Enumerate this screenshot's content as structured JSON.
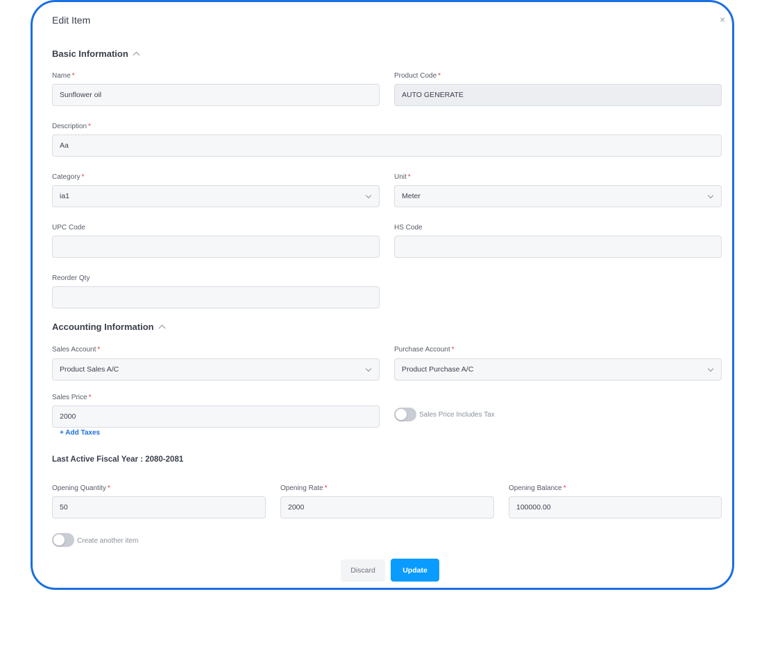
{
  "dialog": {
    "title": "Edit Item",
    "close_label": "×"
  },
  "basic": {
    "title": "Basic Information",
    "name": {
      "label": "Name",
      "value": "Sunflower oil"
    },
    "product_code": {
      "label": "Product Code",
      "value": "AUTO GENERATE"
    },
    "description": {
      "label": "Description",
      "value": "Aa"
    },
    "category": {
      "label": "Category",
      "value": "ia1"
    },
    "unit": {
      "label": "Unit",
      "value": "Meter"
    },
    "upc_code": {
      "label": "UPC Code",
      "value": ""
    },
    "hs_code": {
      "label": "HS Code",
      "value": ""
    },
    "reorder_qty": {
      "label": "Reorder Qty",
      "value": ""
    }
  },
  "accounting": {
    "title": "Accounting Information",
    "sales_account": {
      "label": "Sales Account",
      "value": "Product Sales A/C"
    },
    "purchase_account": {
      "label": "Purchase Account",
      "value": "Product Purchase A/C"
    },
    "sales_price": {
      "label": "Sales Price",
      "value": "2000"
    },
    "tax_toggle": {
      "label": "Sales Price Includes Tax",
      "on": false
    },
    "add_taxes": "+ Add Taxes"
  },
  "opening": {
    "fiscal_year": "Last Active Fiscal Year : 2080-2081",
    "quantity": {
      "label": "Opening Quantity",
      "value": "50"
    },
    "rate": {
      "label": "Opening Rate",
      "value": "2000"
    },
    "balance": {
      "label": "Opening Balance",
      "value": "100000.00"
    }
  },
  "create_another": {
    "label": "Create another item",
    "on": false
  },
  "actions": {
    "discard": "Discard",
    "update": "Update"
  },
  "required_mark": "*",
  "colors": {
    "accent": "#0a9bff",
    "border": "#1a6fe0",
    "required": "#e03b3b",
    "link": "#1a6fe0"
  }
}
